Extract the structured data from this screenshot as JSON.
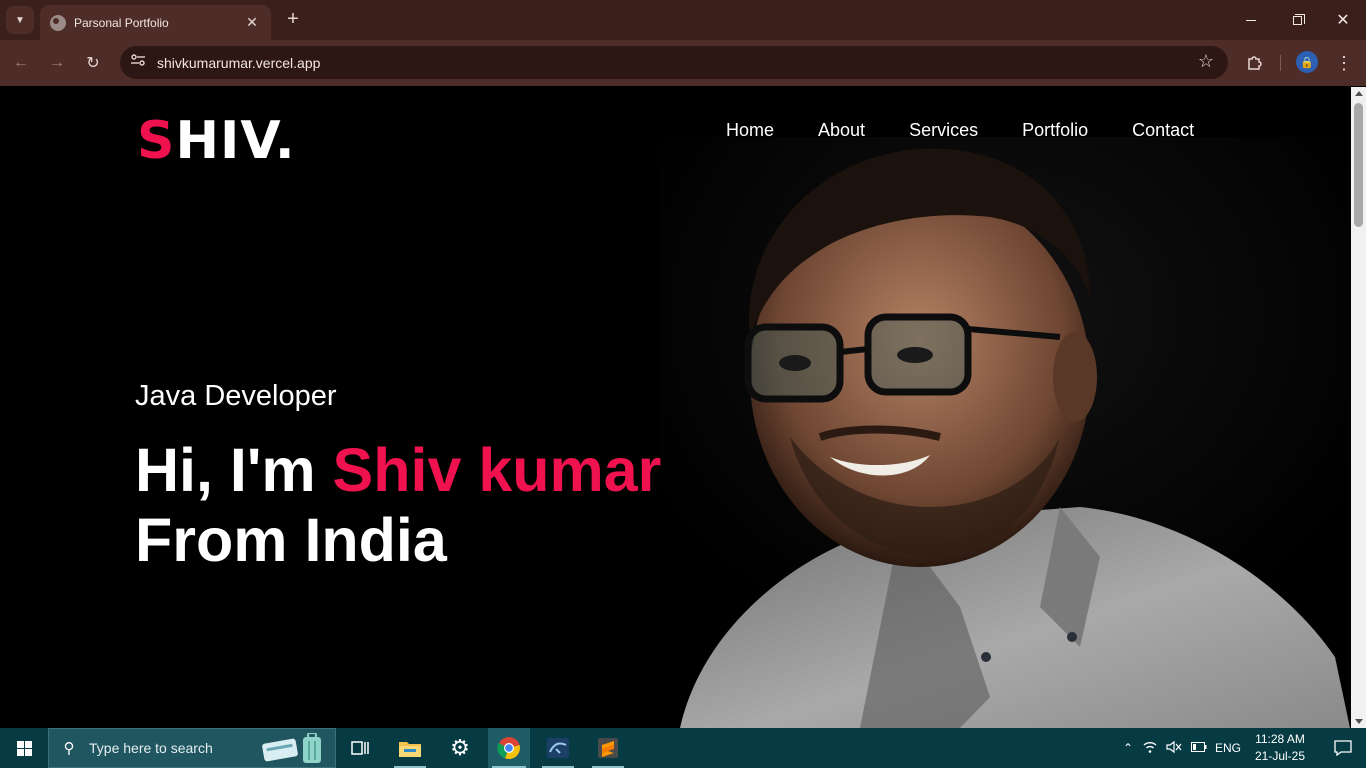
{
  "browser": {
    "tab_title": "Parsonal Portfolio",
    "url": "shivkumarumar.vercel.app",
    "new_tab_label": "+"
  },
  "site": {
    "logo_first": "S",
    "logo_rest": "HIV.",
    "nav": [
      "Home",
      "About",
      "Services",
      "Portfolio",
      "Contact"
    ],
    "hero": {
      "subtitle": "Java Developer",
      "greeting": "Hi, I'm ",
      "name": "Shiv kumar",
      "line2": "From India"
    },
    "accent_color": "#f0114f"
  },
  "taskbar": {
    "search_placeholder": "Type here to search",
    "language": "ENG",
    "time": "11:28 AM",
    "date": "21-Jul-25",
    "pinned": [
      "task-view-icon",
      "file-explorer-icon",
      "settings-icon",
      "chrome-icon",
      "mysql-workbench-icon",
      "sublime-text-icon"
    ]
  }
}
